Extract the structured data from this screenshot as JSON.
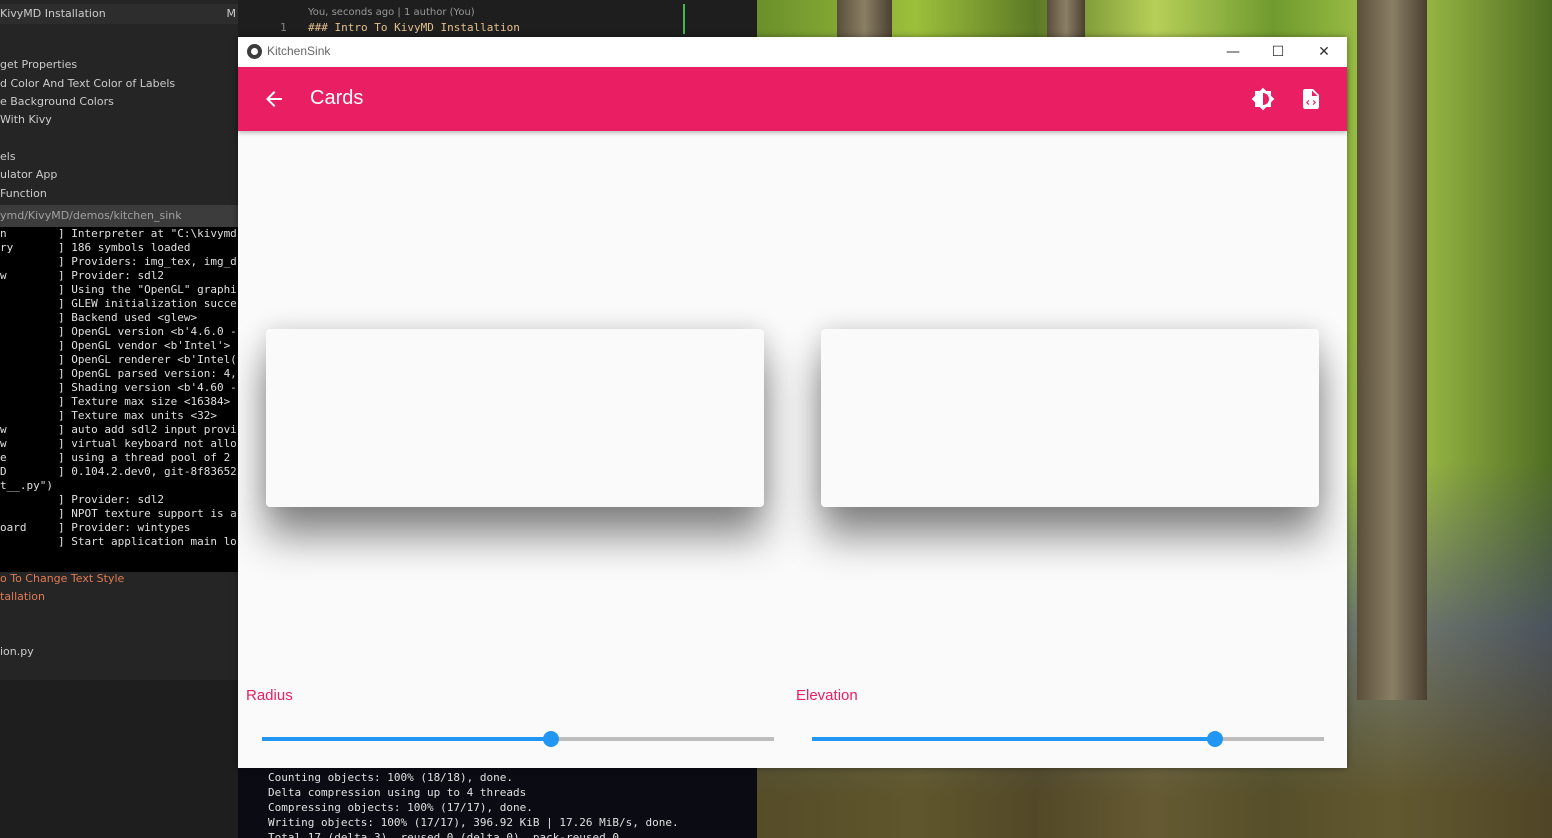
{
  "editor": {
    "tree": {
      "header": "KivyMD Installation",
      "header_mark": "M",
      "items": [
        "get Properties",
        "d Color And Text Color of Labels",
        "e Background Colors",
        " With Kivy",
        "els",
        "ulator App",
        " Function"
      ],
      "bottom_items": [
        "o To Change Text Style",
        "tallation",
        "ion.py"
      ]
    },
    "terminal_path": "ymd/KivyMD/demos/kitchen_sink",
    "code": {
      "blame": "You, seconds ago | 1 author (You)",
      "line_number": "1",
      "line_text": "### Intro To KivyMD Installation"
    },
    "terminal_lines": [
      {
        "l": "n",
        "r": "] Interpreter at \"C:\\kivymd"
      },
      {
        "l": "ry",
        "r": "] 186 symbols loaded"
      },
      {
        "l": "",
        "r": "] Providers: img_tex, img_d"
      },
      {
        "l": "w",
        "r": "] Provider: sdl2"
      },
      {
        "l": "",
        "r": "] Using the \"OpenGL\" graphi"
      },
      {
        "l": "",
        "r": "] GLEW initialization succe"
      },
      {
        "l": "",
        "r": "] Backend used <glew>"
      },
      {
        "l": "",
        "r": "] OpenGL version <b'4.6.0 -"
      },
      {
        "l": "",
        "r": "] OpenGL vendor <b'Intel'>"
      },
      {
        "l": "",
        "r": "] OpenGL renderer <b'Intel("
      },
      {
        "l": "",
        "r": "] OpenGL parsed version: 4,"
      },
      {
        "l": "",
        "r": "] Shading version <b'4.60 -"
      },
      {
        "l": "",
        "r": "] Texture max size <16384>"
      },
      {
        "l": "",
        "r": "] Texture max units <32>"
      },
      {
        "l": "w",
        "r": "] auto add sdl2 input provi"
      },
      {
        "l": "w",
        "r": "] virtual keyboard not allo"
      },
      {
        "l": "e",
        "r": "] using a thread pool of 2 "
      },
      {
        "l": "D",
        "r": "] 0.104.2.dev0, git-8f83652"
      },
      {
        "l": "t__.py\")",
        "r": ""
      },
      {
        "l": "",
        "r": "] Provider: sdl2"
      },
      {
        "l": "",
        "r": "] NPOT texture support is a"
      },
      {
        "l": "oard",
        "r": "] Provider: wintypes"
      },
      {
        "l": "",
        "r": "] Start application main lo"
      }
    ],
    "git_lines": [
      "Counting objects: 100% (18/18), done.",
      "Delta compression using up to 4 threads",
      "Compressing objects: 100% (17/17), done.",
      "Writing objects: 100% (17/17), 396.92 KiB | 17.26 MiB/s, done.",
      "Total 17 (delta 3), reused 0 (delta 0), pack-reused 0"
    ]
  },
  "window": {
    "title": "KitchenSink",
    "minimize_symbol": "—",
    "maximize_symbol": "☐",
    "close_symbol": "✕"
  },
  "appbar": {
    "title": "Cards",
    "back_icon": "arrow-left-icon",
    "actions": [
      "theme-brightness-icon",
      "file-code-icon"
    ],
    "color": "#e91e63"
  },
  "sliders": {
    "radius": {
      "label": "Radius",
      "value_fraction": 0.565
    },
    "elevation": {
      "label": "Elevation",
      "value_fraction": 0.788
    }
  },
  "colors": {
    "accent": "#e91e63",
    "slider": "#2196f3"
  }
}
